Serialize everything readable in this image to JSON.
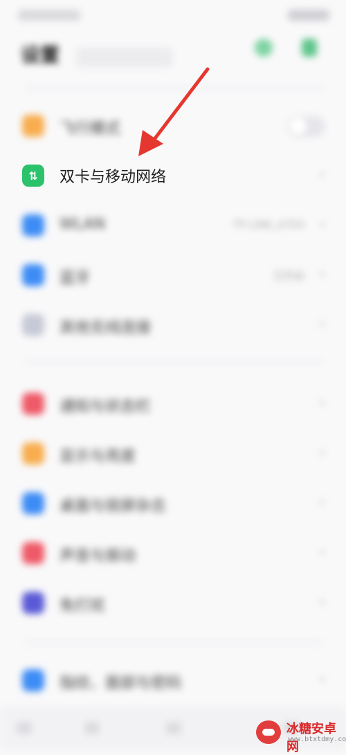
{
  "header": {
    "title": "设置"
  },
  "section1": [
    {
      "name": "airplane",
      "label": "飞行模式",
      "icon": "airplane-icon",
      "color": "#f8ad4e",
      "toggle": true
    },
    {
      "name": "dual-sim",
      "label": "双卡与移动网络",
      "icon": "sim-arrows-icon",
      "color": "#2cc26b",
      "glyph": "⇅"
    },
    {
      "name": "wlan",
      "label": "WLAN",
      "value": "TP-LINK_A7E4",
      "icon": "wifi-icon",
      "color": "#3d8cf5"
    },
    {
      "name": "bluetooth",
      "label": "蓝牙",
      "value": "已开启",
      "icon": "bluetooth-icon",
      "color": "#3d8cf5"
    },
    {
      "name": "other-wireless",
      "label": "其他无线连接",
      "icon": "link-icon",
      "color": "#c7cad6"
    }
  ],
  "section2": [
    {
      "name": "notifications",
      "label": "通知与状态栏",
      "icon": "bell-icon",
      "color": "#ee5a67"
    },
    {
      "name": "display",
      "label": "显示与亮度",
      "icon": "sun-icon",
      "color": "#f8ad4e"
    },
    {
      "name": "desktop",
      "label": "桌面与锁屏杂志",
      "icon": "desktop-icon",
      "color": "#3d8cf5"
    },
    {
      "name": "sound",
      "label": "声音与振动",
      "icon": "speaker-icon",
      "color": "#ee5a67"
    },
    {
      "name": "dnd",
      "label": "免打扰",
      "icon": "moon-icon",
      "color": "#5a5ad6"
    }
  ],
  "section3": [
    {
      "name": "fingerprint",
      "label": "指纹、面部与密码",
      "icon": "fingerprint-icon",
      "color": "#3d8cf5"
    }
  ],
  "watermark": {
    "name": "冰糖安卓网",
    "url": "www.btxtdmy.com"
  },
  "colors": {
    "arrow": "#e5372f"
  }
}
